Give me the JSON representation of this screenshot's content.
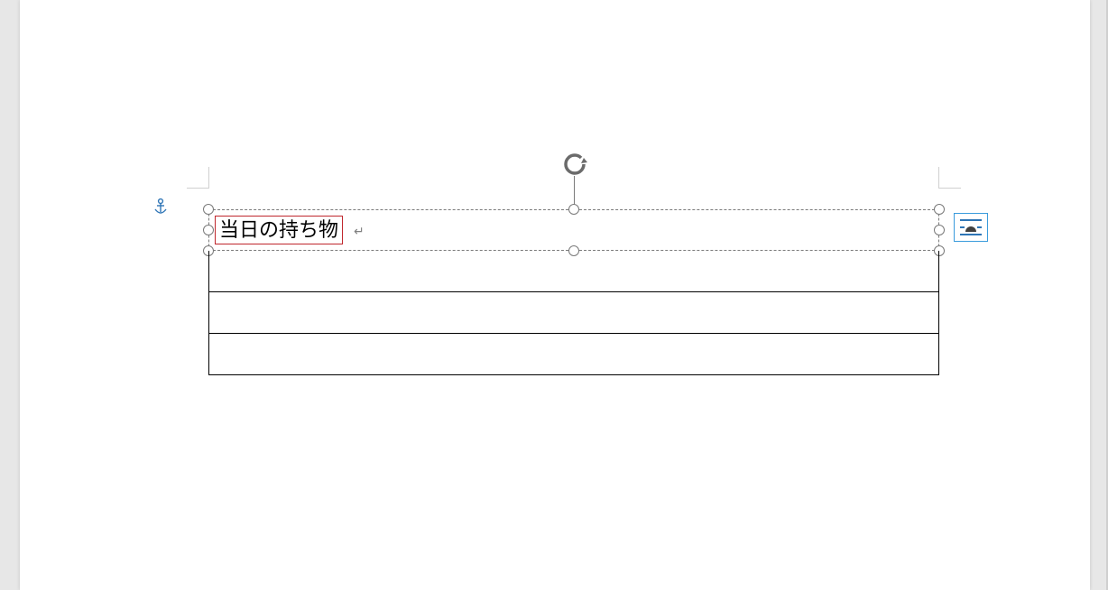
{
  "textbox": {
    "content": "当日の持ち物"
  },
  "paragraph_mark": "↵",
  "table": {
    "rows": [
      "",
      "",
      ""
    ]
  },
  "icons": {
    "anchor": "anchor-icon",
    "rotation": "rotation-handle-icon",
    "layout_options": "layout-options-icon"
  },
  "colors": {
    "highlight_border": "#c0272d",
    "selection_handle": "#7a7a7a",
    "layout_button_border": "#3a9bdc",
    "page_bg": "#ffffff",
    "canvas_bg": "#e7e7e7"
  }
}
